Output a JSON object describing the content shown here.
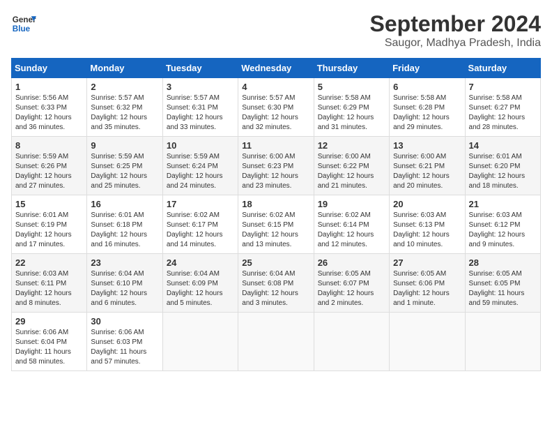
{
  "logo": {
    "line1": "General",
    "line2": "Blue"
  },
  "title": "September 2024",
  "subtitle": "Saugor, Madhya Pradesh, India",
  "weekdays": [
    "Sunday",
    "Monday",
    "Tuesday",
    "Wednesday",
    "Thursday",
    "Friday",
    "Saturday"
  ],
  "weeks": [
    [
      {
        "day": 1,
        "sunrise": "5:56 AM",
        "sunset": "6:33 PM",
        "daylight": "12 hours and 36 minutes."
      },
      {
        "day": 2,
        "sunrise": "5:57 AM",
        "sunset": "6:32 PM",
        "daylight": "12 hours and 35 minutes."
      },
      {
        "day": 3,
        "sunrise": "5:57 AM",
        "sunset": "6:31 PM",
        "daylight": "12 hours and 33 minutes."
      },
      {
        "day": 4,
        "sunrise": "5:57 AM",
        "sunset": "6:30 PM",
        "daylight": "12 hours and 32 minutes."
      },
      {
        "day": 5,
        "sunrise": "5:58 AM",
        "sunset": "6:29 PM",
        "daylight": "12 hours and 31 minutes."
      },
      {
        "day": 6,
        "sunrise": "5:58 AM",
        "sunset": "6:28 PM",
        "daylight": "12 hours and 29 minutes."
      },
      {
        "day": 7,
        "sunrise": "5:58 AM",
        "sunset": "6:27 PM",
        "daylight": "12 hours and 28 minutes."
      }
    ],
    [
      {
        "day": 8,
        "sunrise": "5:59 AM",
        "sunset": "6:26 PM",
        "daylight": "12 hours and 27 minutes."
      },
      {
        "day": 9,
        "sunrise": "5:59 AM",
        "sunset": "6:25 PM",
        "daylight": "12 hours and 25 minutes."
      },
      {
        "day": 10,
        "sunrise": "5:59 AM",
        "sunset": "6:24 PM",
        "daylight": "12 hours and 24 minutes."
      },
      {
        "day": 11,
        "sunrise": "6:00 AM",
        "sunset": "6:23 PM",
        "daylight": "12 hours and 23 minutes."
      },
      {
        "day": 12,
        "sunrise": "6:00 AM",
        "sunset": "6:22 PM",
        "daylight": "12 hours and 21 minutes."
      },
      {
        "day": 13,
        "sunrise": "6:00 AM",
        "sunset": "6:21 PM",
        "daylight": "12 hours and 20 minutes."
      },
      {
        "day": 14,
        "sunrise": "6:01 AM",
        "sunset": "6:20 PM",
        "daylight": "12 hours and 18 minutes."
      }
    ],
    [
      {
        "day": 15,
        "sunrise": "6:01 AM",
        "sunset": "6:19 PM",
        "daylight": "12 hours and 17 minutes."
      },
      {
        "day": 16,
        "sunrise": "6:01 AM",
        "sunset": "6:18 PM",
        "daylight": "12 hours and 16 minutes."
      },
      {
        "day": 17,
        "sunrise": "6:02 AM",
        "sunset": "6:17 PM",
        "daylight": "12 hours and 14 minutes."
      },
      {
        "day": 18,
        "sunrise": "6:02 AM",
        "sunset": "6:15 PM",
        "daylight": "12 hours and 13 minutes."
      },
      {
        "day": 19,
        "sunrise": "6:02 AM",
        "sunset": "6:14 PM",
        "daylight": "12 hours and 12 minutes."
      },
      {
        "day": 20,
        "sunrise": "6:03 AM",
        "sunset": "6:13 PM",
        "daylight": "12 hours and 10 minutes."
      },
      {
        "day": 21,
        "sunrise": "6:03 AM",
        "sunset": "6:12 PM",
        "daylight": "12 hours and 9 minutes."
      }
    ],
    [
      {
        "day": 22,
        "sunrise": "6:03 AM",
        "sunset": "6:11 PM",
        "daylight": "12 hours and 8 minutes."
      },
      {
        "day": 23,
        "sunrise": "6:04 AM",
        "sunset": "6:10 PM",
        "daylight": "12 hours and 6 minutes."
      },
      {
        "day": 24,
        "sunrise": "6:04 AM",
        "sunset": "6:09 PM",
        "daylight": "12 hours and 5 minutes."
      },
      {
        "day": 25,
        "sunrise": "6:04 AM",
        "sunset": "6:08 PM",
        "daylight": "12 hours and 3 minutes."
      },
      {
        "day": 26,
        "sunrise": "6:05 AM",
        "sunset": "6:07 PM",
        "daylight": "12 hours and 2 minutes."
      },
      {
        "day": 27,
        "sunrise": "6:05 AM",
        "sunset": "6:06 PM",
        "daylight": "12 hours and 1 minute."
      },
      {
        "day": 28,
        "sunrise": "6:05 AM",
        "sunset": "6:05 PM",
        "daylight": "11 hours and 59 minutes."
      }
    ],
    [
      {
        "day": 29,
        "sunrise": "6:06 AM",
        "sunset": "6:04 PM",
        "daylight": "11 hours and 58 minutes."
      },
      {
        "day": 30,
        "sunrise": "6:06 AM",
        "sunset": "6:03 PM",
        "daylight": "11 hours and 57 minutes."
      },
      null,
      null,
      null,
      null,
      null
    ]
  ]
}
